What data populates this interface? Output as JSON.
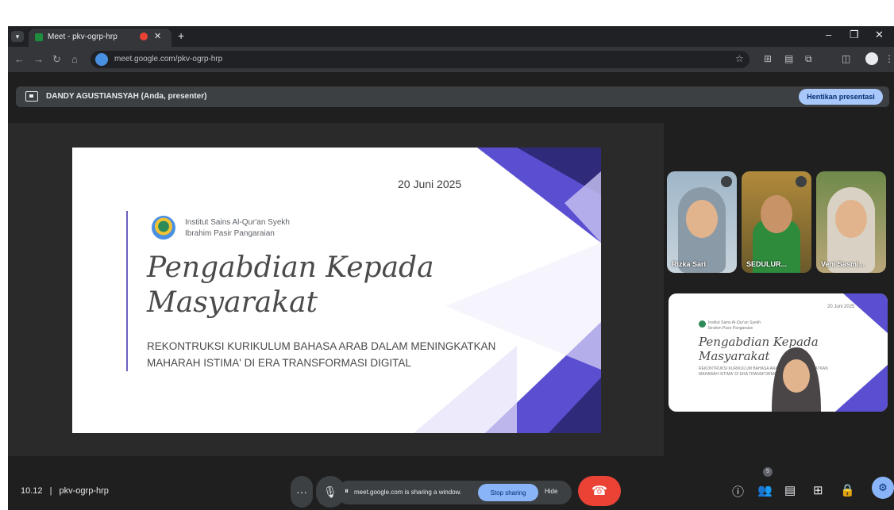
{
  "browser": {
    "tab_title": "Meet - pkv-ogrp-hrp",
    "tab_close": "✕",
    "new_tab": "+",
    "url": "meet.google.com/pkv-ogrp-hrp",
    "window_controls": [
      "–",
      "❐",
      "✕"
    ]
  },
  "presenter_bar": {
    "name": "DANDY AGUSTIANSYAH (Anda, presenter)",
    "stop_button": "Hentikan presentasi"
  },
  "slide": {
    "date": "20 Juni 2025",
    "institution_line1": "Institut Sains Al-Qur'an Syekh",
    "institution_line2": "Ibrahim Pasir Pangaraian",
    "title_line1": "Pengabdian Kepada",
    "title_line2": "Masyarakat",
    "subtitle": "REKONTRUKSI KURIKULUM BAHASA ARAB DALAM MENINGKATKAN MAHARAH ISTIMA' DI ERA TRANSFORMASI DIGITAL",
    "accent_color": "#5b4fd1"
  },
  "participants": [
    {
      "name": "Rizka Sari",
      "badge": "···"
    },
    {
      "name": "SEDULUR...",
      "badge": ""
    },
    {
      "name": "Veni Sasmi..."
    }
  ],
  "self_view": {
    "mini_date": "20 Juni 2025",
    "mini_title_line1": "Pengabdian Kepada",
    "mini_title_line2": "Masyarakat"
  },
  "controls": {
    "time": "10.12",
    "separator": "|",
    "meeting_code": "pkv-ogrp-hrp",
    "more_label": "···",
    "mic_icon": "mic-icon",
    "share_notice_text": "meet.google.com is sharing a window.",
    "stop_sharing": "Stop sharing",
    "hide": "Hide",
    "people_count": "5"
  },
  "colors": {
    "browser_bg": "#1f1f1f",
    "stop_presenting_bg": "#a8c7fa",
    "end_call": "#ea4335",
    "host_control": "#8ab4f8"
  }
}
